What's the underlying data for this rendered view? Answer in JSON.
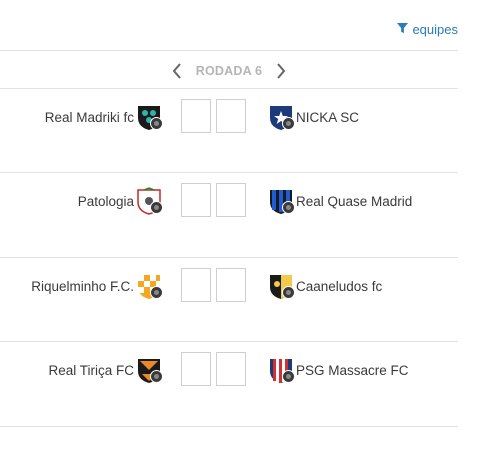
{
  "filter": {
    "label": "equipes",
    "icon": "filter-icon",
    "color": "#2b7bb9"
  },
  "round": {
    "label": "RODADA 6",
    "prev_icon": "chevron-left-icon",
    "next_icon": "chevron-right-icon"
  },
  "matches": [
    {
      "home": {
        "name": "Real Madriki fc",
        "crest_icon": "crest-green-black-icon"
      },
      "away": {
        "name": "NICKA SC",
        "crest_icon": "crest-navy-star-icon"
      },
      "home_score": "",
      "away_score": ""
    },
    {
      "home": {
        "name": "Patologia",
        "crest_icon": "crest-white-red-icon"
      },
      "away": {
        "name": "Real Quase Madrid",
        "crest_icon": "crest-blue-black-stripes-icon"
      },
      "home_score": "",
      "away_score": ""
    },
    {
      "home": {
        "name": "Riquelminho F.C.",
        "crest_icon": "crest-orange-check-icon"
      },
      "away": {
        "name": "Caaneludos fc",
        "crest_icon": "crest-black-yellow-icon"
      },
      "home_score": "",
      "away_score": ""
    },
    {
      "home": {
        "name": "Real Tiriça FC",
        "crest_icon": "crest-orange-black-icon"
      },
      "away": {
        "name": "PSG Massacre FC",
        "crest_icon": "crest-red-white-blue-icon"
      },
      "home_score": "",
      "away_score": ""
    }
  ]
}
